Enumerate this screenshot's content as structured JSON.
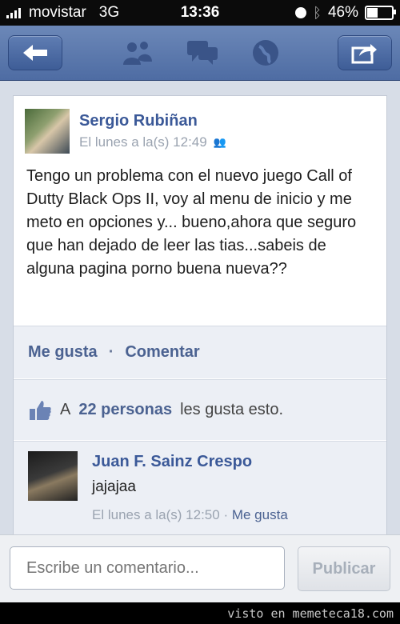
{
  "status_bar": {
    "carrier": "movistar",
    "network": "3G",
    "time": "13:36",
    "battery": "46%",
    "battery_level": 0.46
  },
  "nav": {
    "icons": [
      "back-arrow-icon",
      "friends-icon",
      "messages-icon",
      "globe-icon",
      "share-icon"
    ]
  },
  "post": {
    "author": "Sergio Rubiñan",
    "timestamp": "El lunes a la(s) 12:49",
    "text": "Tengo un problema con el nuevo juego Call of Dutty Black Ops II, voy al menu de inicio y me meto en opciones y... bueno,ahora que seguro que han dejado de leer las tias...sabeis de alguna pagina porno buena nueva??",
    "like_action": "Me gusta",
    "separator": "·",
    "comment_action": "Comentar",
    "likes_prefix": "A",
    "likes_count": "22 personas",
    "likes_suffix": "les gusta esto."
  },
  "comment": {
    "author": "Juan F. Sainz Crespo",
    "text": "jajajaa",
    "timestamp": "El lunes a la(s) 12:50",
    "separator": "·",
    "like_action": "Me gusta"
  },
  "compose": {
    "placeholder": "Escribe un comentario...",
    "publish_label": "Publicar"
  },
  "watermark": "visto en memeteca18.com",
  "colors": {
    "nav_blue": "#4e6ca3",
    "link_blue": "#3b5998",
    "feed_bg": "#d7dde7"
  }
}
